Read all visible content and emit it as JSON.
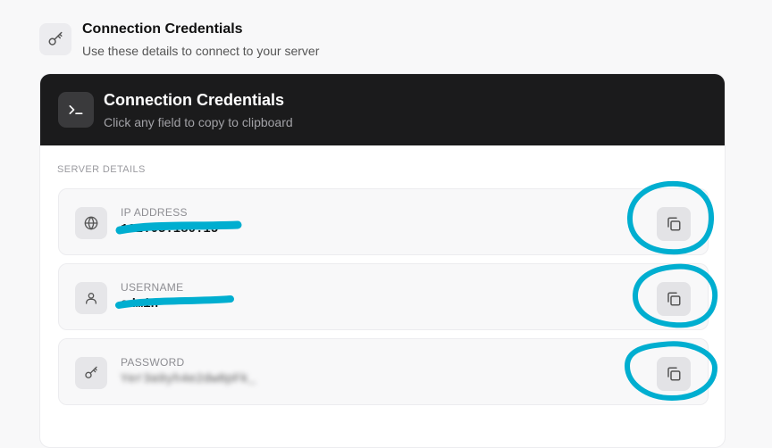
{
  "top": {
    "title": "Connection Credentials",
    "subtitle": "Use these details to connect to your server",
    "icon": "key-icon"
  },
  "card": {
    "title": "Connection Credentials",
    "subtitle": "Click any field to copy to clipboard",
    "icon": "terminal-icon",
    "section_label": "SERVER DETAILS"
  },
  "fields": [
    {
      "label": "IP ADDRESS",
      "value": "192.03.180.15",
      "icon": "globe-icon",
      "redacted": true
    },
    {
      "label": "USERNAME",
      "value": "admin",
      "icon": "user-icon",
      "redacted": true
    },
    {
      "label": "PASSWORD",
      "value": "Yer3a9yh4e2dw8pFk_",
      "icon": "key-icon",
      "redacted": true
    }
  ],
  "colors": {
    "header_bg": "#1b1b1c",
    "page_bg": "#f8f8f9",
    "annotation": "#00aed0"
  }
}
